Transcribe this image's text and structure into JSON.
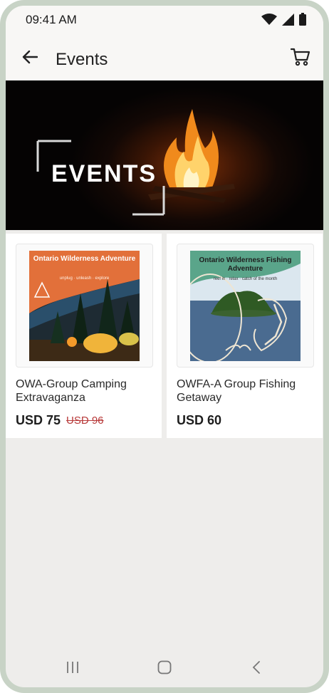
{
  "status_bar": {
    "time": "09:41 AM"
  },
  "app_bar": {
    "title": "Events"
  },
  "banner": {
    "text": "EVENTS"
  },
  "products": [
    {
      "title": "OWA-Group Camping Extravaganza",
      "price": "USD 75",
      "old_price": "USD 96",
      "thumb_title": "Ontario Wilderness Adventure",
      "thumb_subtitle": "unplug · unleash · explore"
    },
    {
      "title": "OWFA-A Group Fishing Getaway",
      "price": "USD 60",
      "old_price": "",
      "thumb_title": "Ontario Wilderness Fishing Adventure",
      "thumb_subtitle": "reel in · relax · catch of the month"
    }
  ],
  "colors": {
    "accent_orange": "#e2703a",
    "accent_teal": "#5aa58a",
    "sale_red": "#b83a3a",
    "frame": "#c8d3c6"
  }
}
